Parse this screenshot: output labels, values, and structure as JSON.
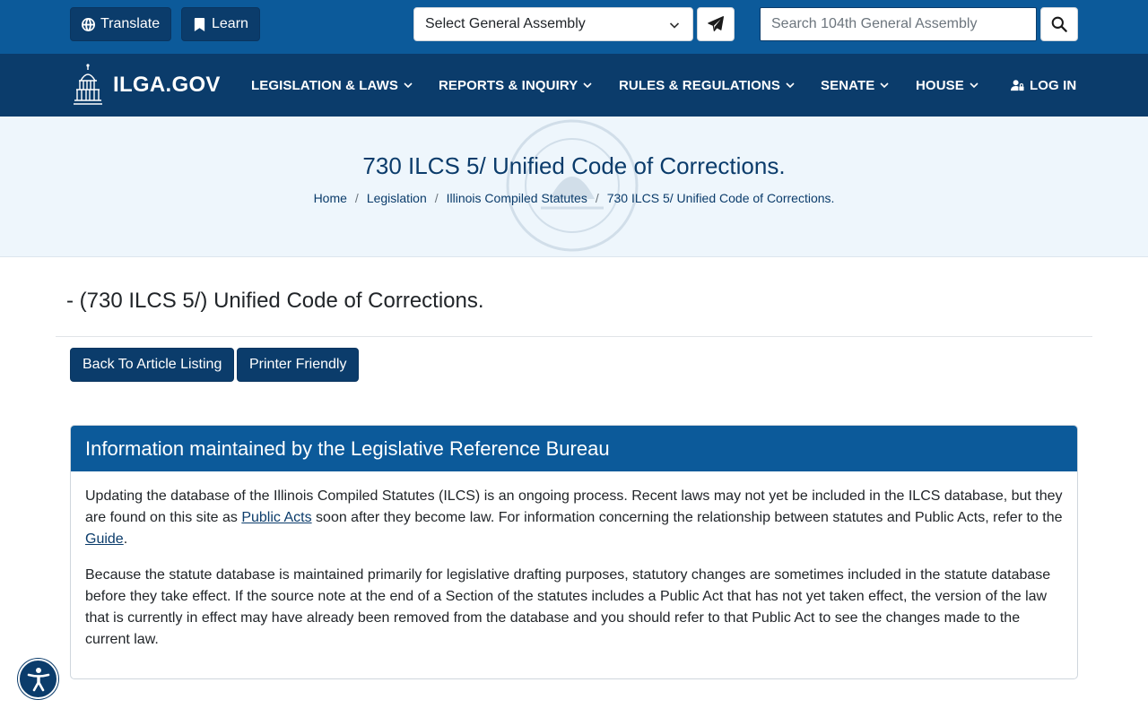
{
  "topbar": {
    "translate_label": "Translate",
    "learn_label": "Learn",
    "assembly_select_value": "Select General Assembly",
    "search_placeholder": "Search 104th General Assembly"
  },
  "nav": {
    "logo_text": "ILGA.GOV",
    "items": [
      {
        "label": "LEGISLATION & LAWS"
      },
      {
        "label": "REPORTS & INQUIRY"
      },
      {
        "label": "RULES & REGULATIONS"
      },
      {
        "label": "SENATE"
      },
      {
        "label": "HOUSE"
      }
    ],
    "login_label": "LOG IN"
  },
  "hero": {
    "title": "730 ILCS 5/ Unified Code of Corrections.",
    "breadcrumb": [
      "Home",
      "Legislation",
      "Illinois Compiled Statutes",
      "730 ILCS 5/ Unified Code of Corrections."
    ],
    "separator": "/"
  },
  "main": {
    "heading": "- (730 ILCS 5/) Unified Code of Corrections.",
    "back_button": "Back To Article Listing",
    "printer_button": "Printer Friendly"
  },
  "info_card": {
    "title": "Information maintained by the Legislative Reference Bureau",
    "p1_part1": "Updating the database of the Illinois Compiled Statutes (ILCS) is an ongoing process. Recent laws may not yet be included in the ILCS database, but they are found on this site as ",
    "p1_link1": "Public Acts",
    "p1_part2": " soon after they become law. For information concerning the relationship between statutes and Public Acts, refer to the ",
    "p1_link2": "Guide",
    "p1_part3": ".",
    "p2": "Because the statute database is maintained primarily for legislative drafting purposes, statutory changes are sometimes included in the statute database before they take effect. If the source note at the end of a Section of the statutes includes a Public Act that has not yet taken effect, the version of the law that is currently in effect may have already been removed from the database and you should refer to that Public Act to see the changes made to the current law."
  },
  "colors": {
    "topbar_bg": "#0c5a9a",
    "navbar_bg": "#0b3c6b",
    "hero_bg": "#eef6fc",
    "primary_button": "#0b3c6b"
  },
  "icons": {
    "translate": "globe-icon",
    "learn": "bookmark-icon",
    "send": "paper-plane-icon",
    "search": "search-icon",
    "login": "user-lock-icon",
    "accessibility": "accessibility-icon"
  }
}
